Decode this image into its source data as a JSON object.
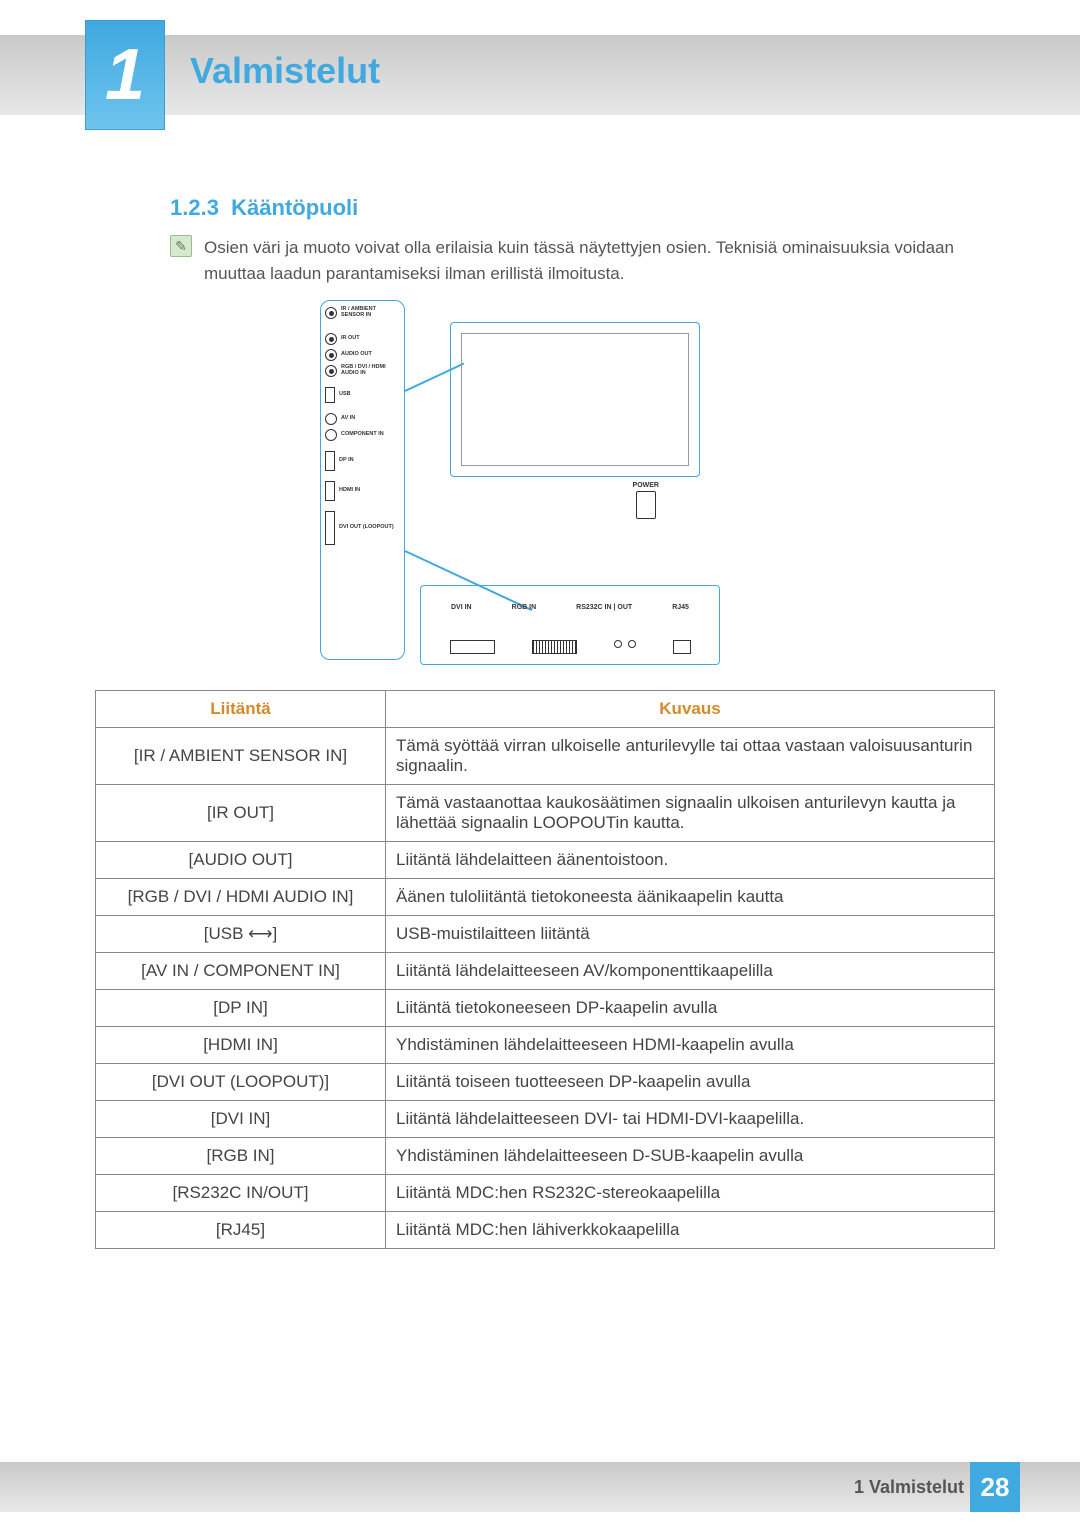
{
  "chapter": {
    "number": "1",
    "title": "Valmistelut"
  },
  "section": {
    "number": "1.2.3",
    "title": "Kääntöpuoli"
  },
  "note": "Osien väri ja muoto voivat olla erilaisia kuin tässä näytettyjen osien. Teknisiä ominaisuuksia voidaan muuttaa laadun parantamiseksi ilman erillistä ilmoitusta.",
  "diagram": {
    "side_ports": [
      "IR / AMBIENT SENSOR IN",
      "IR OUT",
      "AUDIO OUT",
      "RGB / DVI / HDMI AUDIO IN",
      "USB",
      "AV IN",
      "COMPONENT IN",
      "DP IN",
      "HDMI IN",
      "DVI OUT (LOOPOUT)"
    ],
    "bottom_ports": [
      "DVI IN",
      "RGB IN",
      "RS232C IN | OUT",
      "RJ45"
    ],
    "power_label": "POWER"
  },
  "table": {
    "headers": {
      "port": "Liitäntä",
      "desc": "Kuvaus"
    },
    "rows": [
      {
        "port": "[IR / AMBIENT SENSOR IN]",
        "desc": "Tämä syöttää virran ulkoiselle anturilevylle tai ottaa vastaan valoisuusanturin signaalin."
      },
      {
        "port": "[IR OUT]",
        "desc": "Tämä vastaanottaa kaukosäätimen signaalin ulkoisen anturilevyn kautta ja lähettää signaalin LOOPOUTin kautta."
      },
      {
        "port": "[AUDIO OUT]",
        "desc": "Liitäntä lähdelaitteen äänentoistoon."
      },
      {
        "port": "[RGB / DVI / HDMI AUDIO IN]",
        "desc": "Äänen tuloliitäntä tietokoneesta äänikaapelin kautta"
      },
      {
        "port": "[USB ⟷]",
        "desc": "USB-muistilaitteen liitäntä"
      },
      {
        "port": "[AV IN / COMPONENT IN]",
        "desc": "Liitäntä lähdelaitteeseen AV/komponenttikaapelilla"
      },
      {
        "port": "[DP IN]",
        "desc": "Liitäntä tietokoneeseen DP-kaapelin avulla"
      },
      {
        "port": "[HDMI IN]",
        "desc": "Yhdistäminen lähdelaitteeseen HDMI-kaapelin avulla"
      },
      {
        "port": "[DVI OUT (LOOPOUT)]",
        "desc": "Liitäntä toiseen tuotteeseen DP-kaapelin avulla"
      },
      {
        "port": "[DVI IN]",
        "desc": "Liitäntä lähdelaitteeseen DVI- tai HDMI-DVI-kaapelilla."
      },
      {
        "port": "[RGB IN]",
        "desc": "Yhdistäminen lähdelaitteeseen D-SUB-kaapelin avulla"
      },
      {
        "port": "[RS232C IN/OUT]",
        "desc": "Liitäntä MDC:hen RS232C-stereokaapelilla"
      },
      {
        "port": "[RJ45]",
        "desc": "Liitäntä MDC:hen lähiverkkokaapelilla"
      }
    ]
  },
  "footer": {
    "chapter_ref": "1 Valmistelut",
    "page": "28"
  }
}
